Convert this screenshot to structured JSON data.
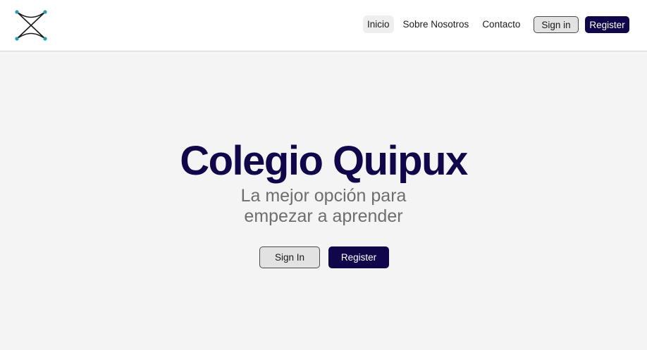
{
  "header": {
    "logo_icon": "x-crossed-lines-logo-icon",
    "nav": [
      {
        "label": "Inicio",
        "active": true
      },
      {
        "label": "Sobre Nosotros",
        "active": false
      },
      {
        "label": "Contacto",
        "active": false
      }
    ],
    "signin_label": "Sign in",
    "register_label": "Register"
  },
  "hero": {
    "title": "Colegio Quipux",
    "subtitle": "La mejor opción para empezar a aprender",
    "signin_label": "Sign In",
    "register_label": "Register"
  },
  "colors": {
    "primary": "#10064a",
    "logo_accent": "#2a9bb0",
    "background": "#f4f4f4"
  }
}
